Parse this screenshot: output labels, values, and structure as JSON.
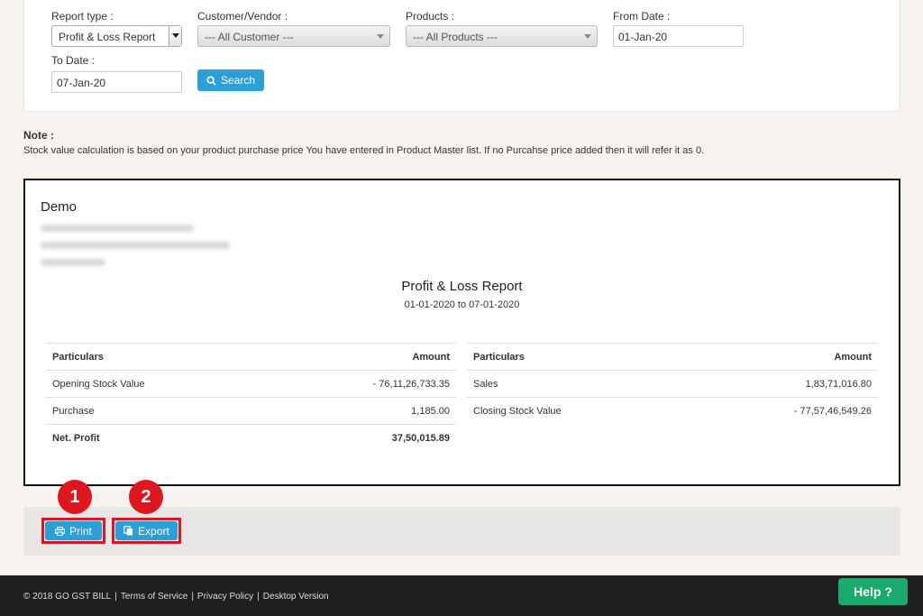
{
  "filters": {
    "report_type_label": "Report type :",
    "report_type_value": "Profit & Loss Report",
    "customer_label": "Customer/Vendor :",
    "customer_value": "--- All Customer ---",
    "products_label": "Products :",
    "products_value": "--- All Products ---",
    "from_date_label": "From Date :",
    "from_date_value": "01-Jan-20",
    "to_date_label": "To Date :",
    "to_date_value": "07-Jan-20",
    "search_label": "Search"
  },
  "note": {
    "title": "Note :",
    "text": "Stock value calculation is based on your product purchase price You have entered in Product Master list. If no Purcahse price added then it will refer it as 0."
  },
  "report": {
    "company": "Demo",
    "title": "Profit & Loss Report",
    "period": "01-01-2020 to 07-01-2020",
    "left_table": {
      "headers": [
        "Particulars",
        "Amount"
      ],
      "rows": [
        [
          "Opening Stock Value",
          "- 76,11,26,733.35"
        ],
        [
          "Purchase",
          "1,185.00"
        ],
        [
          "Net. Profit",
          "37,50,015.89"
        ]
      ]
    },
    "right_table": {
      "headers": [
        "Particulars",
        "Amount"
      ],
      "rows": [
        [
          "Sales",
          "1,83,71,016.80"
        ],
        [
          "Closing Stock Value",
          "- 77,57,46,549.26"
        ]
      ]
    }
  },
  "actions": {
    "print_label": "Print",
    "export_label": "Export",
    "marker_1": "1",
    "marker_2": "2"
  },
  "footer": {
    "copyright": "© 2018 GO GST BILL",
    "sep": "|",
    "terms": "Terms of Service",
    "privacy": "Privacy Policy",
    "desktop": "Desktop Version",
    "help": "Help ?"
  },
  "colors": {
    "accent": "#2a9fd8",
    "highlight": "#e0161e",
    "help": "#1aaa6e"
  },
  "icons": [
    "search-icon",
    "print-icon",
    "export-icon"
  ]
}
